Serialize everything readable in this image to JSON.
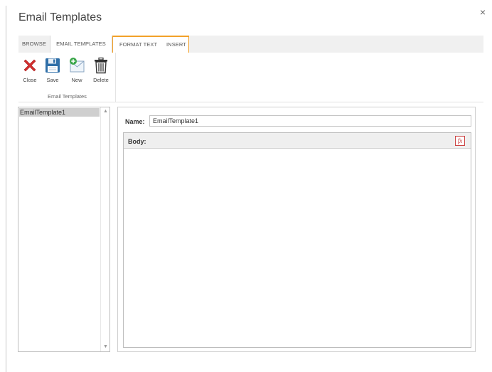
{
  "dialog": {
    "title": "Email Templates",
    "close_glyph": "×"
  },
  "tabs": {
    "browse": "BROWSE",
    "email_templates": "EMAIL TEMPLATES",
    "format_text": "FORMAT TEXT",
    "insert": "INSERT"
  },
  "ribbon": {
    "buttons": {
      "close": "Close",
      "save": "Save",
      "new": "New",
      "delete": "Delete"
    },
    "group_label": "Email Templates"
  },
  "template_list": {
    "items": [
      "EmailTemplate1"
    ],
    "scroll_up_glyph": "▲",
    "scroll_down_glyph": "▼"
  },
  "editor": {
    "name_label": "Name:",
    "name_value": "EmailTemplate1",
    "body_label": "Body:",
    "fx_label": "fx"
  },
  "icons": {
    "close": "close-x-icon",
    "save": "floppy-disk-icon",
    "new": "new-email-icon",
    "delete": "trash-can-icon",
    "fx": "formula-icon"
  },
  "colors": {
    "tab_accent": "#f2a12a",
    "close_icon": "#d32f2f",
    "save_icon": "#2f6fa8",
    "new_icon_plus": "#3aa64a",
    "fx_icon": "#c62828"
  }
}
